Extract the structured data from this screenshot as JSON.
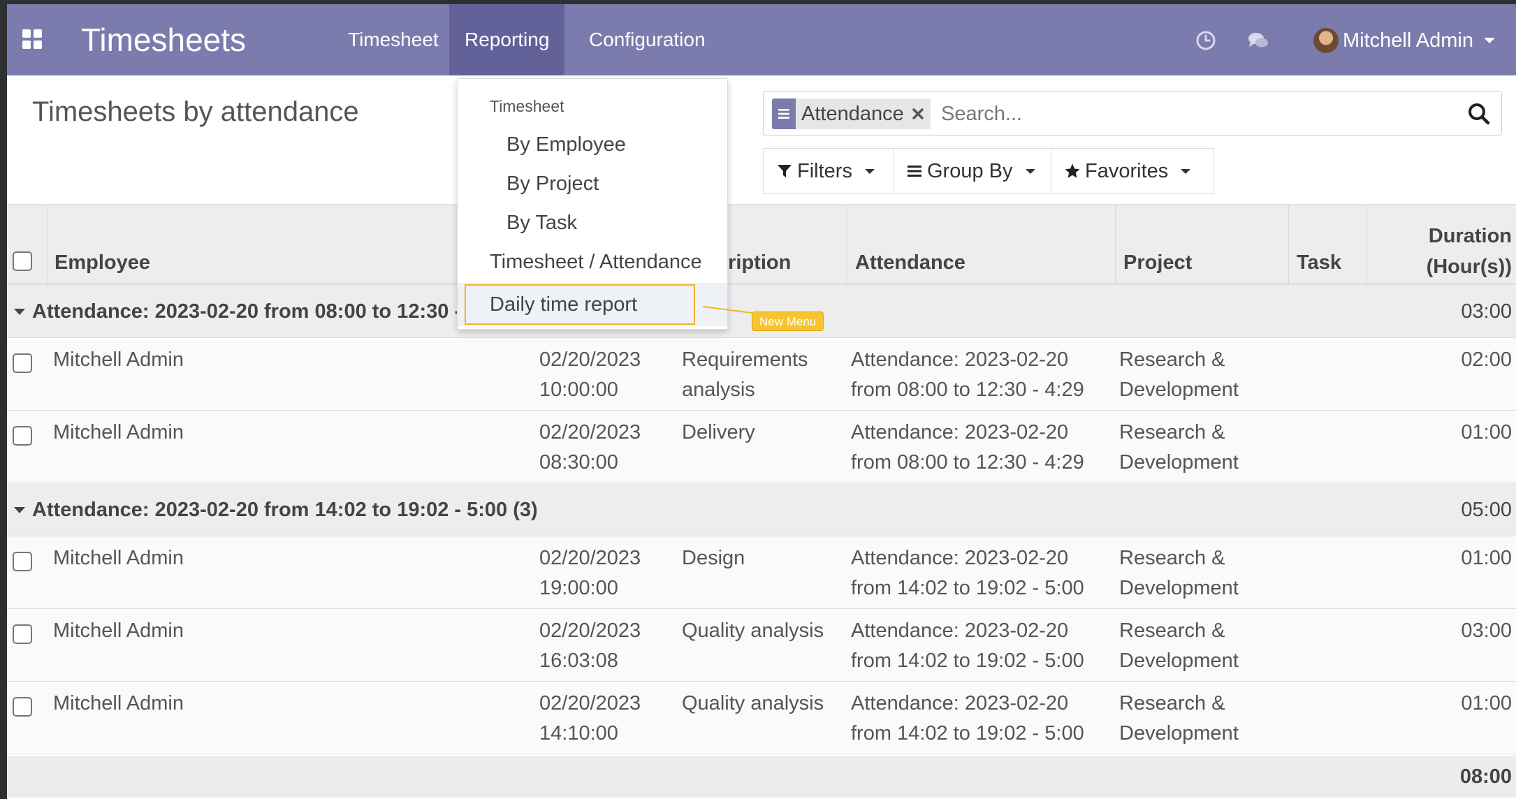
{
  "navbar": {
    "brand": "Timesheets",
    "menus": [
      "Timesheet",
      "Reporting",
      "Configuration"
    ],
    "active_menu": "Reporting",
    "user": "Mitchell Admin",
    "color": "#7c7bad"
  },
  "control_panel": {
    "title": "Timesheets by attendance",
    "facet_label": "Attendance",
    "search_placeholder": "Search...",
    "filters_label": "Filters",
    "group_by_label": "Group By",
    "favorites_label": "Favorites"
  },
  "dropdown": {
    "header": "Timesheet",
    "items": [
      "By Employee",
      "By Project",
      "By Task"
    ],
    "flat_items": [
      "Timesheet / Attendance",
      "Daily time report"
    ],
    "callout": "New Menu",
    "highlight_color": "#f2b521"
  },
  "table": {
    "columns": {
      "employee": "Employee",
      "description_fragment": "cription",
      "attendance": "Attendance",
      "project": "Project",
      "task": "Task",
      "duration_line1": "Duration",
      "duration_line2": "(Hour(s))"
    },
    "groups": [
      {
        "label": "Attendance: 2023-02-20 from 08:00 to 12:30 -",
        "total": "03:00",
        "rows": [
          {
            "employee": "Mitchell Admin",
            "date1": "02/20/2023",
            "date2": "10:00:00",
            "desc1": "Requirements",
            "desc2": "analysis",
            "att1": "Attendance: 2023-02-20",
            "att2": "from 08:00 to 12:30 - 4:29",
            "proj1": "Research &",
            "proj2": "Development",
            "duration": "02:00"
          },
          {
            "employee": "Mitchell Admin",
            "date1": "02/20/2023",
            "date2": "08:30:00",
            "desc1": "Delivery",
            "desc2": "",
            "att1": "Attendance: 2023-02-20",
            "att2": "from 08:00 to 12:30 - 4:29",
            "proj1": "Research &",
            "proj2": "Development",
            "duration": "01:00"
          }
        ]
      },
      {
        "label": "Attendance: 2023-02-20 from 14:02 to 19:02 - 5:00 (3)",
        "total": "05:00",
        "rows": [
          {
            "employee": "Mitchell Admin",
            "date1": "02/20/2023",
            "date2": "19:00:00",
            "desc1": "Design",
            "desc2": "",
            "att1": "Attendance: 2023-02-20",
            "att2": "from 14:02 to 19:02 - 5:00",
            "proj1": "Research &",
            "proj2": "Development",
            "duration": "01:00"
          },
          {
            "employee": "Mitchell Admin",
            "date1": "02/20/2023",
            "date2": "16:03:08",
            "desc1": "Quality analysis",
            "desc2": "",
            "att1": "Attendance: 2023-02-20",
            "att2": "from 14:02 to 19:02 - 5:00",
            "proj1": "Research &",
            "proj2": "Development",
            "duration": "03:00"
          },
          {
            "employee": "Mitchell Admin",
            "date1": "02/20/2023",
            "date2": "14:10:00",
            "desc1": "Quality analysis",
            "desc2": "",
            "att1": "Attendance: 2023-02-20",
            "att2": "from 14:02 to 19:02 - 5:00",
            "proj1": "Research &",
            "proj2": "Development",
            "duration": "01:00"
          }
        ]
      }
    ],
    "grand_total": "08:00"
  }
}
